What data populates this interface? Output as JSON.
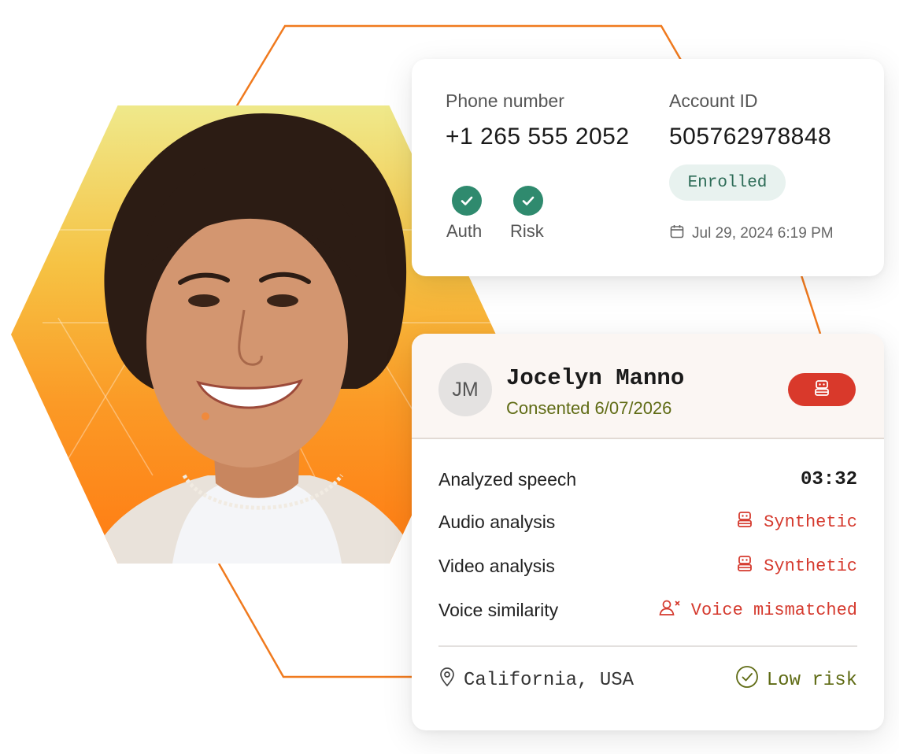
{
  "identity": {
    "phone_label": "Phone number",
    "phone_value": "+1 265 555 2052",
    "account_label": "Account ID",
    "account_value": "505762978848",
    "checks": [
      {
        "label": "Auth",
        "icon": "check-circle-icon"
      },
      {
        "label": "Risk",
        "icon": "check-circle-icon"
      }
    ],
    "status_badge": "Enrolled",
    "timestamp": "Jul 29, 2024 6:19 PM"
  },
  "caller": {
    "initials": "JM",
    "name": "Jocelyn Manno",
    "consent": "Consented 6/07/2026",
    "badge_icon": "robot-icon"
  },
  "analysis": {
    "rows": [
      {
        "label": "Analyzed speech",
        "value": "03:32"
      },
      {
        "label": "Audio analysis",
        "value": "Synthetic",
        "icon": "robot-icon"
      },
      {
        "label": "Video analysis",
        "value": "Synthetic",
        "icon": "robot-icon"
      },
      {
        "label": "Voice similarity",
        "value": "Voice mismatched",
        "icon": "user-x-icon"
      }
    ],
    "location": "California, USA",
    "risk": "Low risk"
  },
  "colors": {
    "accent_orange": "#ff7a12",
    "check_green": "#2f8a6e",
    "alert_red": "#d53a2e",
    "olive": "#5f6b14"
  }
}
